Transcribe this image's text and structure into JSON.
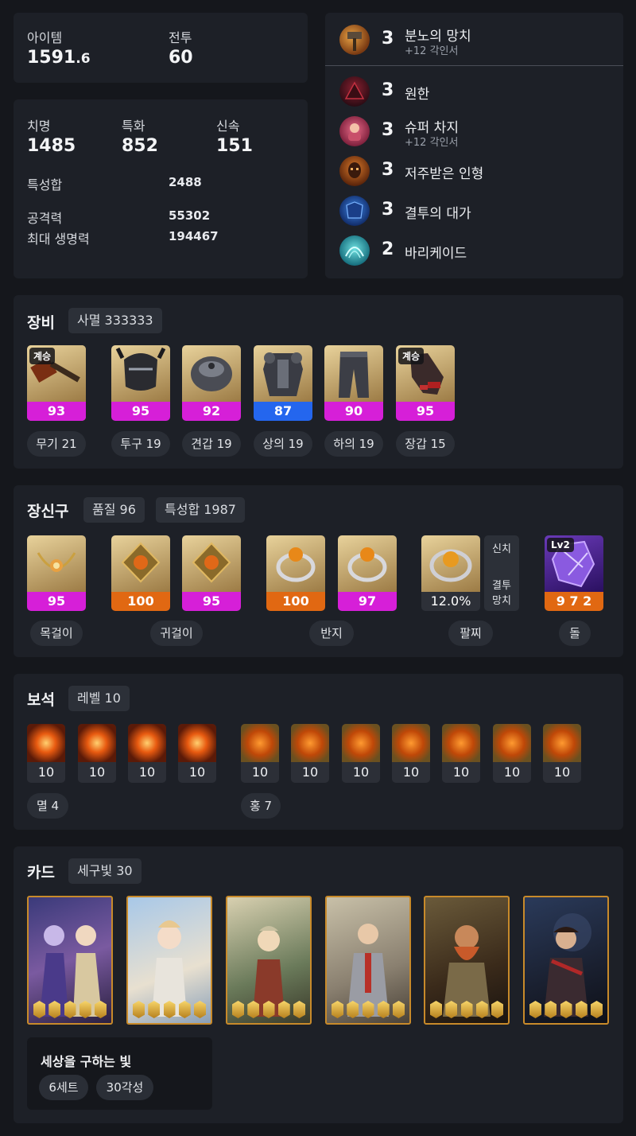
{
  "summary": {
    "item_label": "아이템",
    "item_main": "1591",
    "item_decimal": ".6",
    "combat_label": "전투",
    "combat_value": "60"
  },
  "stats": {
    "crit_label": "치명",
    "crit_value": "1485",
    "spec_label": "특화",
    "spec_value": "852",
    "swift_label": "신속",
    "swift_value": "151",
    "total_label": "특성합",
    "total_value": "2488",
    "atk_label": "공격력",
    "atk_value": "55302",
    "hp_label": "최대 생명력",
    "hp_value": "194467"
  },
  "engravings": [
    {
      "icon": "hammer-icon",
      "level": "3",
      "name": "분노의 망치",
      "sub": "+12 각인서"
    },
    {
      "icon": "grudge-icon",
      "level": "3",
      "name": "원한",
      "sub": ""
    },
    {
      "icon": "super-charge-icon",
      "level": "3",
      "name": "슈퍼 차지",
      "sub": "+12 각인서"
    },
    {
      "icon": "cursed-doll-icon",
      "level": "3",
      "name": "저주받은 인형",
      "sub": ""
    },
    {
      "icon": "determination-icon",
      "level": "3",
      "name": "결투의 대가",
      "sub": ""
    },
    {
      "icon": "barricade-icon",
      "level": "2",
      "name": "바리케이드",
      "sub": ""
    }
  ],
  "equipment": {
    "title": "장비",
    "set_label": "사멸 333333",
    "inherit_tag": "계승",
    "items": [
      {
        "icon": "weapon-icon",
        "quality": "93",
        "color": "#d61fd8",
        "label": "무기 21",
        "inherit": true
      },
      {
        "icon": "helmet-icon",
        "quality": "95",
        "color": "#d61fd8",
        "label": "투구 19",
        "inherit": false
      },
      {
        "icon": "shoulder-icon",
        "quality": "92",
        "color": "#d61fd8",
        "label": "견갑 19",
        "inherit": false
      },
      {
        "icon": "chest-armor-icon",
        "quality": "87",
        "color": "#2466ee",
        "label": "상의 19",
        "inherit": false
      },
      {
        "icon": "pants-icon",
        "quality": "90",
        "color": "#d61fd8",
        "label": "하의 19",
        "inherit": false
      },
      {
        "icon": "gloves-icon",
        "quality": "95",
        "color": "#d61fd8",
        "label": "장갑 15",
        "inherit": true
      }
    ]
  },
  "accessories": {
    "title": "장신구",
    "quality_label": "품질 96",
    "total_label": "특성합 1987",
    "items": [
      {
        "icon": "necklace-icon",
        "value": "95",
        "color": "#d61fd8"
      },
      {
        "icon": "earring-icon",
        "value": "100",
        "color": "#e16812"
      },
      {
        "icon": "earring-icon",
        "value": "95",
        "color": "#d61fd8"
      },
      {
        "icon": "ring-icon",
        "value": "100",
        "color": "#e16812"
      },
      {
        "icon": "ring-icon",
        "value": "97",
        "color": "#d61fd8"
      }
    ],
    "bracelet": {
      "icon": "bracelet-icon",
      "value": "12.0%",
      "tag1": "신치",
      "tag2a": "결투",
      "tag2b": "망치"
    },
    "stone": {
      "icon": "ability-stone-icon",
      "lv": "Lv2",
      "value": "9 7 2"
    },
    "labels": {
      "necklace": "목걸이",
      "earring": "귀걸이",
      "ring": "반지",
      "bracelet": "팔찌",
      "stone": "돌"
    }
  },
  "gems": {
    "title": "보석",
    "level_label": "레벨 10",
    "annihilation": [
      "10",
      "10",
      "10",
      "10"
    ],
    "crimson": [
      "10",
      "10",
      "10",
      "10",
      "10",
      "10",
      "10"
    ],
    "annihilation_label": "멸 4",
    "crimson_label": "홍 7"
  },
  "cards": {
    "title": "카드",
    "awaken_label": "세구빛 30",
    "items": [
      {
        "icon": "card-portrait-twin-demons",
        "awakening": 5
      },
      {
        "icon": "card-portrait-angel",
        "awakening": 5
      },
      {
        "icon": "card-portrait-elf",
        "awakening": 5
      },
      {
        "icon": "card-portrait-knight",
        "awakening": 5
      },
      {
        "icon": "card-portrait-dwarf",
        "awakening": 5
      },
      {
        "icon": "card-portrait-bandit",
        "awakening": 5
      }
    ],
    "set_name": "세상을 구하는 빛",
    "set_count": "6세트",
    "set_awaken": "30각성"
  }
}
